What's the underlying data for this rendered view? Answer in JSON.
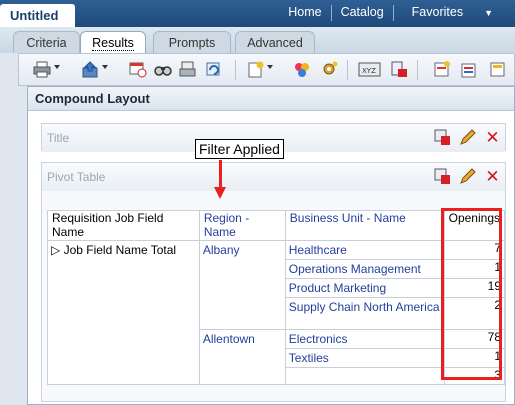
{
  "header": {
    "doc_tab": "Untitled",
    "links": {
      "home": "Home",
      "catalog": "Catalog",
      "favorites": "Favorites"
    }
  },
  "tabs": [
    "Criteria",
    "Results",
    "Prompts",
    "Advanced"
  ],
  "active_tab": "Results",
  "toolbar": {
    "icons": [
      "print-icon",
      "export-icon",
      "schedule-icon",
      "preview-icon",
      "print-preview-icon",
      "refresh-icon",
      "new-view-icon",
      "view-properties-icon",
      "compound-properties-icon",
      "show-xy-icon",
      "edit-view-icon",
      "add-icon",
      "settings-icon"
    ]
  },
  "compound": {
    "title": "Compound Layout",
    "views": {
      "title_view": "Title",
      "pivot_view": "Pivot Table"
    }
  },
  "pivot": {
    "headers": {
      "job_field": "Requisition Job Field Name",
      "region": "Region - Name",
      "business_unit": "Business Unit - Name",
      "openings": "Openings"
    },
    "row_label": "Job Field Name Total",
    "regions": [
      {
        "name": "Albany",
        "units": [
          {
            "name": "Healthcare",
            "openings": "7"
          },
          {
            "name": "Operations Management",
            "openings": "1"
          },
          {
            "name": "Product Marketing",
            "openings": "19"
          },
          {
            "name": "Supply Chain North America",
            "openings": "2"
          }
        ]
      },
      {
        "name": "Allentown",
        "units": [
          {
            "name": "Electronics",
            "openings": "78"
          },
          {
            "name": "Textiles",
            "openings": "1"
          }
        ]
      }
    ],
    "total": "3"
  },
  "annotation": {
    "label": "Filter Applied"
  },
  "colors": {
    "accent": "#e8201f",
    "header_bar": "#2f5f95",
    "link_blue": "#24409c"
  }
}
